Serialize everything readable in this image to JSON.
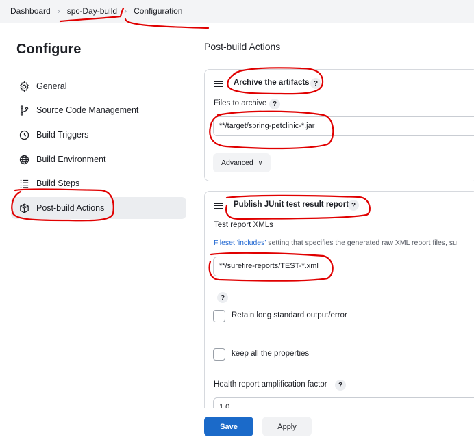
{
  "breadcrumb": {
    "items": [
      "Dashboard",
      "spc-Day-build",
      "Configuration"
    ]
  },
  "sidebar": {
    "title": "Configure",
    "items": [
      {
        "label": "General",
        "icon": "gear-icon"
      },
      {
        "label": "Source Code Management",
        "icon": "branch-icon"
      },
      {
        "label": "Build Triggers",
        "icon": "clock-icon"
      },
      {
        "label": "Build Environment",
        "icon": "globe-icon"
      },
      {
        "label": "Build Steps",
        "icon": "list-icon"
      },
      {
        "label": "Post-build Actions",
        "icon": "package-icon"
      }
    ],
    "active_index": 5
  },
  "main": {
    "section_title": "Post-build Actions",
    "archive": {
      "title": "Archive the artifacts",
      "files_label": "Files to archive",
      "files_value": "**/target/spring-petclinic-*.jar",
      "advanced_label": "Advanced"
    },
    "junit": {
      "title": "Publish JUnit test result report",
      "xml_label": "Test report XMLs",
      "desc_link": "Fileset 'includes'",
      "desc_text": " setting that specifies the generated raw XML report files, su",
      "xml_value": "**/surefire-reports/TEST-*.xml",
      "retain_label": "Retain long standard output/error",
      "keep_label": "keep all the properties",
      "health_label": "Health report amplification factor",
      "health_value": "1.0"
    }
  },
  "footer": {
    "save_label": "Save",
    "apply_label": "Apply"
  },
  "help_glyph": "?",
  "colors": {
    "primary": "#1b6ac9",
    "annotation": "#e00000",
    "active_bg": "#ebedf0"
  }
}
